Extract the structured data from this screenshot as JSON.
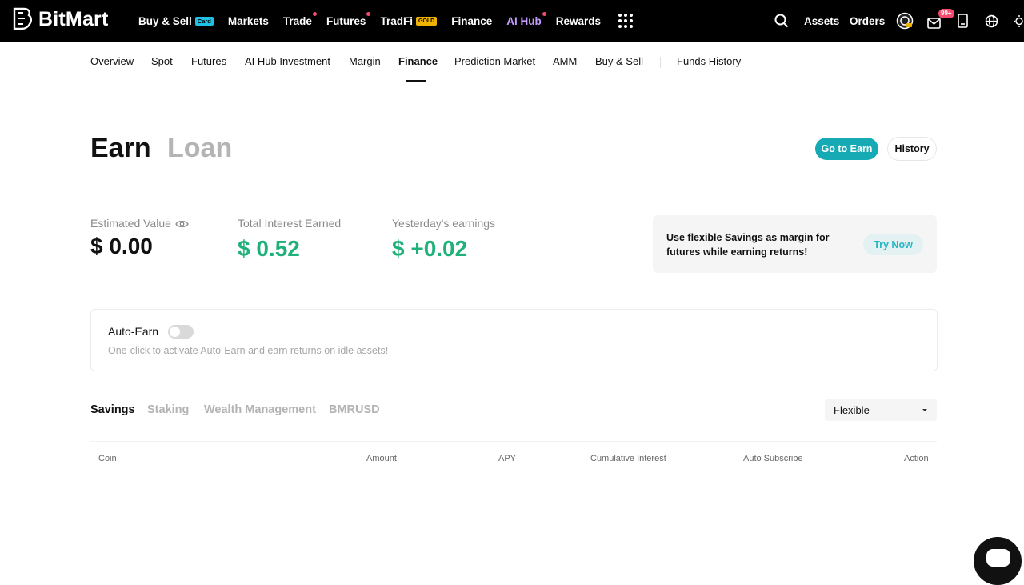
{
  "brand": {
    "name": "BitMart"
  },
  "topnav": {
    "items": [
      {
        "label": "Buy & Sell",
        "badge": "Card"
      },
      {
        "label": "Markets"
      },
      {
        "label": "Trade"
      },
      {
        "label": "Futures"
      },
      {
        "label": "TradFi",
        "badge": "GOLD"
      },
      {
        "label": "Finance"
      },
      {
        "label": "AI Hub"
      },
      {
        "label": "Rewards"
      }
    ],
    "assets": "Assets",
    "orders": "Orders",
    "mail_count": "99+",
    "icons": [
      "search-icon",
      "avatar-icon",
      "mail-icon",
      "device-icon",
      "globe-icon",
      "theme-icon",
      "apps-grid-icon"
    ]
  },
  "subnav": {
    "items": [
      "Overview",
      "Spot",
      "Futures",
      "AI Hub Investment",
      "Margin",
      "Finance",
      "Prediction Market",
      "AMM",
      "Buy & Sell",
      "Funds History"
    ],
    "active": "Finance"
  },
  "header": {
    "earn": "Earn",
    "loan": "Loan",
    "go_to_earn": "Go to Earn",
    "history": "History"
  },
  "stats": {
    "estimated_label": "Estimated Value",
    "estimated_value": "$ 0.00",
    "interest_label": "Total Interest Earned",
    "interest_value": "$ 0.52",
    "yesterday_label": "Yesterday's earnings",
    "yesterday_value": "$ +0.02",
    "accent": "#20b07a"
  },
  "promo": {
    "text": "Use flexible Savings as margin for futures while earning returns!",
    "button": "Try Now"
  },
  "auto_earn": {
    "title": "Auto-Earn",
    "enabled": false,
    "description": "One-click to activate Auto-Earn and earn returns on idle assets!"
  },
  "tabs": {
    "items": [
      "Savings",
      "Staking",
      "Wealth Management",
      "BMRUSD"
    ],
    "active": "Savings",
    "filter_value": "Flexible"
  },
  "table": {
    "columns": [
      "Coin",
      "Amount",
      "APY",
      "Cumulative Interest",
      "Auto Subscribe",
      "Action"
    ]
  }
}
